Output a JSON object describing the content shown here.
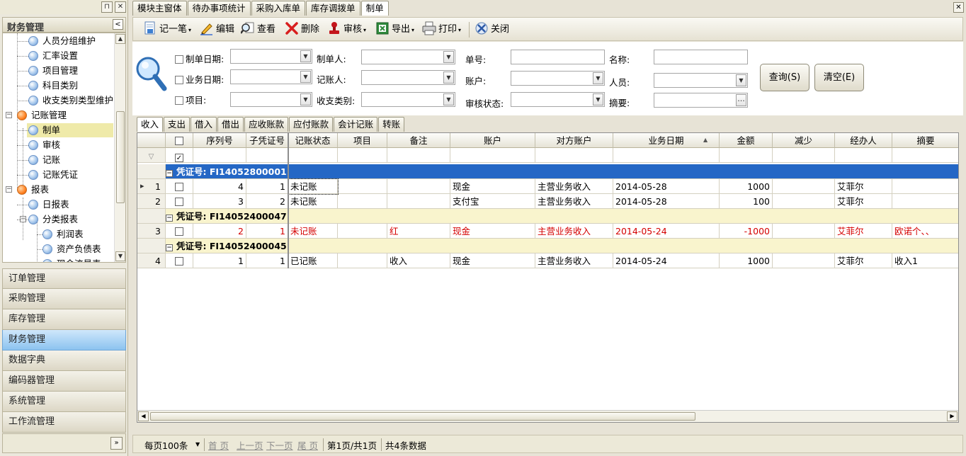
{
  "left_panel": {
    "title": "财务管理",
    "tree": [
      {
        "label": "人员分组维护",
        "level": 2,
        "icon": "blue"
      },
      {
        "label": "汇率设置",
        "level": 2,
        "icon": "blue"
      },
      {
        "label": "项目管理",
        "level": 2,
        "icon": "blue"
      },
      {
        "label": "科目类别",
        "level": 2,
        "icon": "blue"
      },
      {
        "label": "收支类别类型维护",
        "level": 2,
        "icon": "blue"
      },
      {
        "label": "记账管理",
        "level": 1,
        "icon": "orange"
      },
      {
        "label": "制单",
        "level": 2,
        "icon": "blue",
        "selected": true
      },
      {
        "label": "审核",
        "level": 2,
        "icon": "blue"
      },
      {
        "label": "记账",
        "level": 2,
        "icon": "blue"
      },
      {
        "label": "记账凭证",
        "level": 2,
        "icon": "blue"
      },
      {
        "label": "报表",
        "level": 1,
        "icon": "orange"
      },
      {
        "label": "日报表",
        "level": 2,
        "icon": "blue"
      },
      {
        "label": "分类报表",
        "level": 2,
        "icon": "blue"
      },
      {
        "label": "利润表",
        "level": 3,
        "icon": "blue"
      },
      {
        "label": "资产负债表",
        "level": 3,
        "icon": "blue"
      },
      {
        "label": "现金流量表",
        "level": 3,
        "icon": "blue"
      }
    ],
    "nav": [
      "订单管理",
      "采购管理",
      "库存管理",
      "财务管理",
      "数据字典",
      "编码器管理",
      "系统管理",
      "工作流管理"
    ],
    "nav_active": "财务管理"
  },
  "doc_tabs": [
    "模块主窗体",
    "待办事项统计",
    "采购入库单",
    "库存调拨单",
    "制单"
  ],
  "doc_tab_active": "制单",
  "toolbar": {
    "new": "记一笔",
    "edit": "编辑",
    "view": "查看",
    "delete": "删除",
    "audit": "审核",
    "export": "导出",
    "print": "打印",
    "close": "关闭"
  },
  "search": {
    "make_date": "制单日期:",
    "biz_date": "业务日期:",
    "project": "项目:",
    "maker": "制单人:",
    "recorder": "记账人:",
    "category": "收支类别:",
    "doc_no": "单号:",
    "account": "账户:",
    "audit_state": "审核状态:",
    "name": "名称:",
    "person": "人员:",
    "summary": "摘要:",
    "query_btn": "查询(S)",
    "clear_btn": "清空(E)",
    "ellipsis": "..."
  },
  "sub_tabs": [
    "收入",
    "支出",
    "借入",
    "借出",
    "应收账款",
    "应付账款",
    "会计记账",
    "转账"
  ],
  "sub_tab_active": "收入",
  "grid": {
    "columns": [
      "序列号",
      "子凭证号",
      "记账状态",
      "项目",
      "备注",
      "账户",
      "对方账户",
      "业务日期",
      "金额",
      "减少",
      "经办人",
      "摘要"
    ],
    "groups": [
      {
        "label": "凭证号: FI14052800001",
        "rows": [
          {
            "idx": "1",
            "seq": "4",
            "sub": "1",
            "status": "未记账",
            "project": "",
            "remark": "",
            "account": "现金",
            "counter": "主营业务收入",
            "date": "2014-05-28",
            "amount": "1000",
            "decrease": "",
            "handler": "艾菲尔",
            "summary": ""
          },
          {
            "idx": "2",
            "seq": "3",
            "sub": "2",
            "status": "未记账",
            "project": "",
            "remark": "",
            "account": "支付宝",
            "counter": "主营业务收入",
            "date": "2014-05-28",
            "amount": "100",
            "decrease": "",
            "handler": "艾菲尔",
            "summary": ""
          }
        ]
      },
      {
        "label": "凭证号: FI14052400047",
        "rows": [
          {
            "idx": "3",
            "seq": "2",
            "sub": "1",
            "status": "未记账",
            "project": "",
            "remark": "红",
            "account": "现金",
            "counter": "主营业务收入",
            "date": "2014-05-24",
            "amount": "-1000",
            "decrease": "",
            "handler": "艾菲尔",
            "summary": "欧诺个、、",
            "red": true
          }
        ]
      },
      {
        "label": "凭证号: FI14052400045",
        "rows": [
          {
            "idx": "4",
            "seq": "1",
            "sub": "1",
            "status": "已记账",
            "project": "",
            "remark": "收入",
            "account": "现金",
            "counter": "主营业务收入",
            "date": "2014-05-24",
            "amount": "1000",
            "decrease": "",
            "handler": "艾菲尔",
            "summary": "收入1"
          }
        ]
      }
    ]
  },
  "pager": {
    "page_size": "每页100条",
    "first": "首 页",
    "prev": "上一页",
    "next": "下一页",
    "last": "尾 页",
    "page_info": "第1页/共1页",
    "total": "共4条数据"
  }
}
